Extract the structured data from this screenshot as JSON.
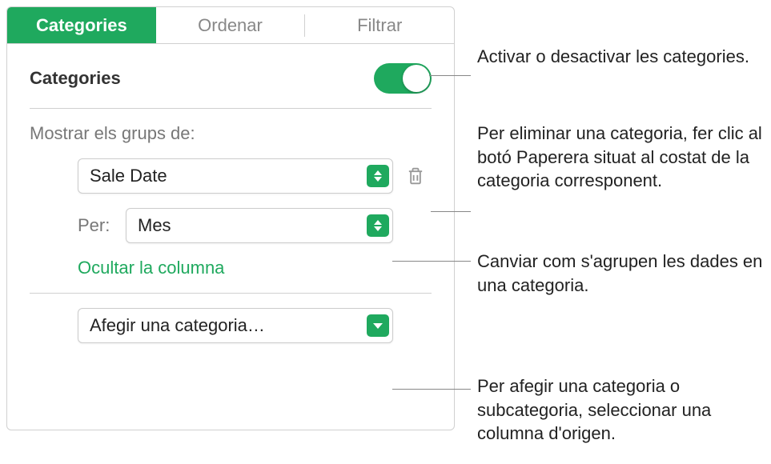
{
  "tabs": {
    "categories": "Categories",
    "sort": "Ordenar",
    "filter": "Filtrar"
  },
  "section": {
    "title": "Categories"
  },
  "groups_label": "Mostrar els grups de:",
  "category_dropdown": "Sale Date",
  "per_label": "Per:",
  "per_dropdown": "Mes",
  "hide_column_link": "Ocultar la columna",
  "add_category_dropdown": "Afegir una categoria…",
  "annotations": {
    "toggle": "Activar o desactivar les categories.",
    "trash": "Per eliminar una categoria, fer clic al botó Paperera situat al costat de la categoria corresponent.",
    "per": "Canviar com s'agrupen les dades en una categoria.",
    "add": "Per afegir una categoria o subcategoria, seleccionar una columna d'origen."
  }
}
